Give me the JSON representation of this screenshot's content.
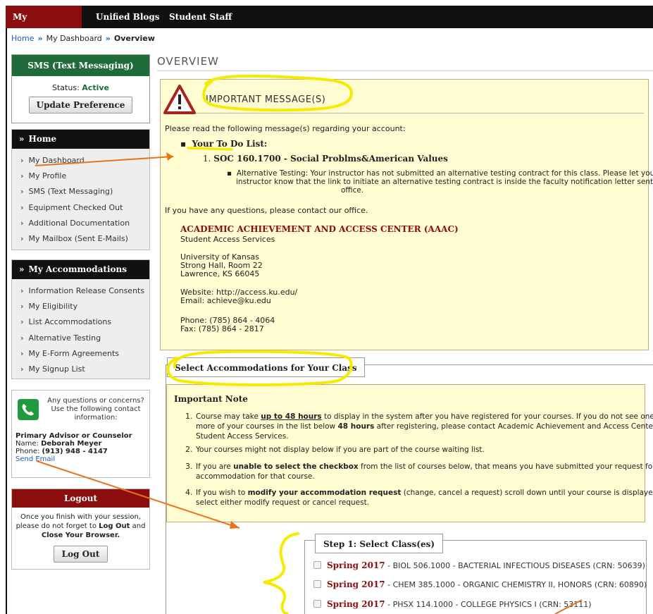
{
  "topnav": {
    "items": [
      "My Dashboard",
      "Unified Blogs",
      "Student Staff"
    ]
  },
  "breadcrumb": {
    "home": "Home",
    "sep": "»",
    "dashboard": "My Dashboard",
    "current": "Overview"
  },
  "sms": {
    "title": "SMS (Text Messaging)",
    "status_label": "Status:",
    "status_value": "Active",
    "button": "Update Preference"
  },
  "home_menu": {
    "title": "Home",
    "items": [
      "My Dashboard",
      "My Profile",
      "SMS (Text Messaging)",
      "Equipment Checked Out",
      "Additional Documentation",
      "My Mailbox (Sent E-Mails)"
    ]
  },
  "accom_menu": {
    "title": "My Accommodations",
    "items": [
      "Information Release Consents",
      "My Eligibility",
      "List Accommodations",
      "Alternative Testing",
      "My E-Form Agreements",
      "My Signup List"
    ]
  },
  "contact": {
    "intro_1": "Any questions or concerns?",
    "intro_2": "Use the following contact",
    "intro_3": "information:",
    "role": "Primary Advisor or Counselor",
    "name_label": "Name:",
    "name": "Deborah Meyer",
    "phone_label": "Phone:",
    "phone": "(913) 948 - 4147",
    "send_email": "Send Email"
  },
  "logout": {
    "title": "Logout",
    "text_1": "Once you finish with your session,",
    "text_2a": "please do not forget to ",
    "text_2b": "Log Out",
    "text_2c": " and",
    "text_3": "Close Your Browser.",
    "button": "Log Out"
  },
  "overview_title": "OVERVIEW",
  "message": {
    "heading": "IMPORTANT MESSAGE(S)",
    "intro": "Please read the following message(s) regarding your account:",
    "todo_label": "Your To Do List:",
    "course_num": "1.",
    "course": "SOC 160.1700 - Social Problms&American Values",
    "detail_1": "Alternative Testing: Your instructor has not submitted an alternative testing contract for this class. Please let your",
    "detail_2": "instructor know that the link to initiate an alternative testing contract is inside the faculty notification letter sent by our",
    "detail_3": "office.",
    "questions": "If you have any questions, please contact our office.",
    "org": "ACADEMIC ACHIEVEMENT AND ACCESS CENTER (AAAC)",
    "dept": "Student Access Services",
    "addr_1": "University of Kansas",
    "addr_2": "Strong Hall, Room 22",
    "addr_3": "Lawrence, KS 66045",
    "website": "Website: http://access.ku.edu/",
    "email": "Email: achieve@ku.edu",
    "phone": "Phone: (785) 864 - 4064",
    "fax": "Fax: (785) 864 - 2817"
  },
  "accommodations": {
    "legend": "Select Accommodations for Your Class",
    "note_title": "Important Note",
    "n1_num": "1.",
    "n1_a": "Course may take ",
    "n1_b": "up to 48 hours",
    "n1_c": " to display in the system after you have registered for your courses. If you do not see one or",
    "n1_d": "more of your courses in the list below ",
    "n1_e": "48 hours",
    "n1_f": " after registering, please contact Academic Achievement and Access Center-",
    "n1_g": "Student Access Services.",
    "n2_num": "2.",
    "n2": "Your courses might not display below if you are part of the course waiting list.",
    "n3_num": "3.",
    "n3_a": "If you are ",
    "n3_b": "unable to select the checkbox",
    "n3_c": " from the list of courses below, that means you have submitted your request for",
    "n3_d": "accommodation for that course.",
    "n4_num": "4.",
    "n4_a": "If you wish to ",
    "n4_b": "modify your accommodation request",
    "n4_c": " (change, cancel a request) scroll down until your course is displayed and",
    "n4_d": "select either modify request or cancel request."
  },
  "step1": {
    "legend": "Step 1: Select Class(es)",
    "classes": [
      {
        "term": "Spring 2017",
        "text": " - BIOL 506.1000 - BACTERIAL INFECTIOUS DISEASES (CRN: 50639)"
      },
      {
        "term": "Spring 2017",
        "text": " - CHEM 385.1000 - ORGANIC CHEMISTRY II, HONORS (CRN: 60890)"
      },
      {
        "term": "Spring 2017",
        "text": " - PHSX 114.1000 - COLLEGE PHYSICS I (CRN: 53111)"
      }
    ]
  },
  "colors": {
    "brand_red": "#8b0e0e",
    "sms_green": "#1f6b3a",
    "message_bg": "#fefcd0",
    "highlight": "#f5ea00",
    "arrow": "#e8731a"
  },
  "icons": {
    "nav_chevron": "chevron-right-icon",
    "menu_collapse": "double-chevron-down-icon",
    "warning": "warning-triangle-icon",
    "phone": "phone-icon"
  }
}
